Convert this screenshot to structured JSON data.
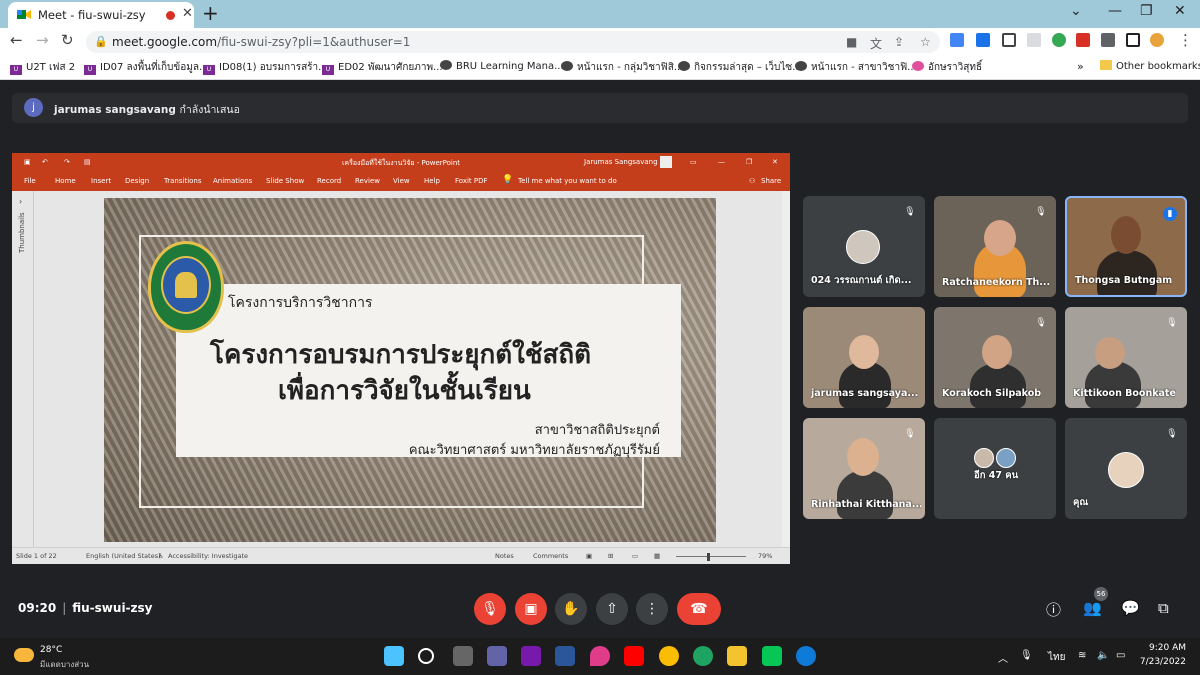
{
  "browser": {
    "tab_title": "Meet - fiu-swui-zsy",
    "url_host": "meet.google.com",
    "url_path": "/fiu-swui-zsy?pli=1&authuser=1",
    "bookmarks": [
      "U2T เฟส 2",
      "ID07 ลงพื้นที่เก็บข้อมูล...",
      "ID08(1) อบรมการสร้า...",
      "ED02 พัฒนาศักยภาพ...",
      "BRU Learning Mana...",
      "หน้าแรก - กลุ่มวิชาฟิสิ...",
      "กิจกรรมล่าสุด – เว็บไซ...",
      "หน้าแรก - สาขาวิชาฟิ...",
      "อักษราวิสุทธิ์"
    ],
    "other_bookmarks": "Other bookmarks"
  },
  "meet": {
    "presenter_initial": "j",
    "presenter_name": "jarumas sangsavang",
    "presenting_label": "กำลังนำเสนอ",
    "time": "09:20",
    "meeting_code": "fiu-swui-zsy",
    "participants_badge": "56",
    "tiles": [
      {
        "name": "024 วรรณกานต์ เกิด...",
        "muted": true
      },
      {
        "name": "Ratchaneekorn Th...",
        "muted": true
      },
      {
        "name": "Thongsa Butngam",
        "muted": false
      },
      {
        "name": "jarumas sangsaya...",
        "muted": false
      },
      {
        "name": "Korakoch Silpakob",
        "muted": true
      },
      {
        "name": "Kittikoon Boonkate",
        "muted": true
      },
      {
        "name": "Rinhathai Kitthana...",
        "muted": true
      },
      {
        "name": "อีก 47 คน",
        "muted": false
      },
      {
        "name": "คุณ",
        "muted": true
      }
    ]
  },
  "ppt": {
    "window_title": "เครื่องมือที่ใช้ในงานวิจัย - PowerPoint",
    "user": "Jarumas Sangsavang",
    "tabs": [
      "File",
      "Home",
      "Insert",
      "Design",
      "Transitions",
      "Animations",
      "Slide Show",
      "Record",
      "Review",
      "View",
      "Help",
      "Foxit PDF"
    ],
    "tell_me": "Tell me what you want to do",
    "share": "Share",
    "thumbnails": "Thumbnails",
    "slide": {
      "top_line": "โครงการบริการวิชาการ",
      "title_line1": "โครงการอบรมการประยุกต์ใช้สถิติ",
      "title_line2": "เพื่อการวิจัยในชั้นเรียน",
      "dept": "สาขาวิชาสถิติประยุกต์",
      "faculty": "คณะวิทยาศาสตร์  มหาวิทยาลัยราชภัฏบุรีรัมย์"
    },
    "status": {
      "slide": "Slide 1 of 22",
      "lang": "English (United States)",
      "access": "Accessibility: Investigate",
      "notes": "Notes",
      "comments": "Comments",
      "zoom": "79%"
    }
  },
  "taskbar": {
    "temp": "28°C",
    "weather": "มีแดดบางส่วน",
    "lang": "ไทย",
    "time": "9:20 AM",
    "date": "7/23/2022"
  }
}
